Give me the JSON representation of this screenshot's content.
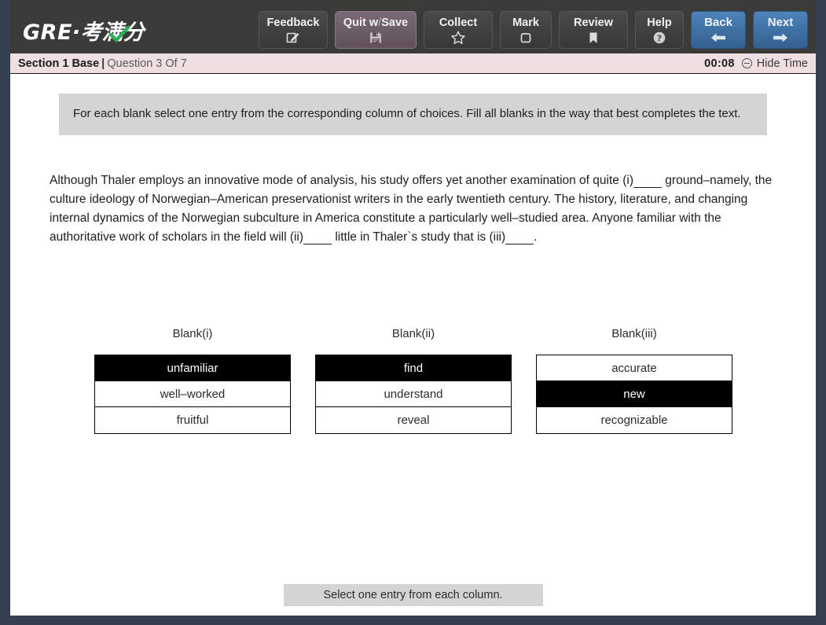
{
  "header": {
    "logo_main": "GRE",
    "logo_dot": "·",
    "logo_cn": "考满分",
    "logo_check_icon": "green-check-icon",
    "accent_blue": "#4e83bb",
    "quit_purple": "#6b5a66",
    "buttons": [
      {
        "label": "Feedback",
        "icon": "edit-note-icon",
        "style": "default"
      },
      {
        "label": "Quit w",
        "slash": "/",
        "label2": "Save",
        "icon": "save-floppy-icon",
        "style": "quit"
      },
      {
        "label": "Collect",
        "icon": "star-outline-icon",
        "style": "default"
      },
      {
        "label": "Mark",
        "icon": "square-outline-icon",
        "style": "default"
      },
      {
        "label": "Review",
        "icon": "bookmark-icon",
        "style": "default"
      },
      {
        "label": "Help",
        "icon": "question-circle-icon",
        "style": "default"
      },
      {
        "label": "Back",
        "icon": "arrow-left-icon",
        "style": "blue"
      },
      {
        "label": "Next",
        "icon": "arrow-right-icon",
        "style": "blue"
      }
    ]
  },
  "section_bar": {
    "section_name": "Section 1 Base",
    "separator": "|",
    "question_progress": "Question 3 Of 7",
    "timer": "00:08",
    "hide_time_label": "Hide Time",
    "hide_time_icon": "minus-circle-icon",
    "background": "#efdfe0"
  },
  "instructions": {
    "text": "For each blank select one entry from the corresponding column of choices. Fill all blanks in the way that best completes the text."
  },
  "passage": {
    "part1": "Although Thaler employs an innovative mode of analysis, his study offers yet another examination of quite (i)",
    "blank1": "_____",
    "part2": " ground–namely, the culture ideology of Norwegian–American preservationist writers in the early twentieth century. The history, literature, and changing internal dynamics of the Norwegian subculture in America constitute a particularly well–studied area. Anyone familiar with the authoritative work of scholars in the field will (ii)",
    "blank2": "_____",
    "part3": " little in Thaler`s study that is (iii)",
    "blank3": "_____",
    "part4": "."
  },
  "columns": [
    {
      "title": "Blank(i)",
      "options": [
        {
          "label": "unfamiliar",
          "selected": true
        },
        {
          "label": "well–worked",
          "selected": false
        },
        {
          "label": "fruitful",
          "selected": false
        }
      ]
    },
    {
      "title": "Blank(ii)",
      "options": [
        {
          "label": "find",
          "selected": true
        },
        {
          "label": "understand",
          "selected": false
        },
        {
          "label": "reveal",
          "selected": false
        }
      ]
    },
    {
      "title": "Blank(iii)",
      "options": [
        {
          "label": "accurate",
          "selected": false
        },
        {
          "label": "new",
          "selected": true
        },
        {
          "label": "recognizable",
          "selected": false
        }
      ]
    }
  ],
  "footer": {
    "note": "Select one entry from each column."
  }
}
